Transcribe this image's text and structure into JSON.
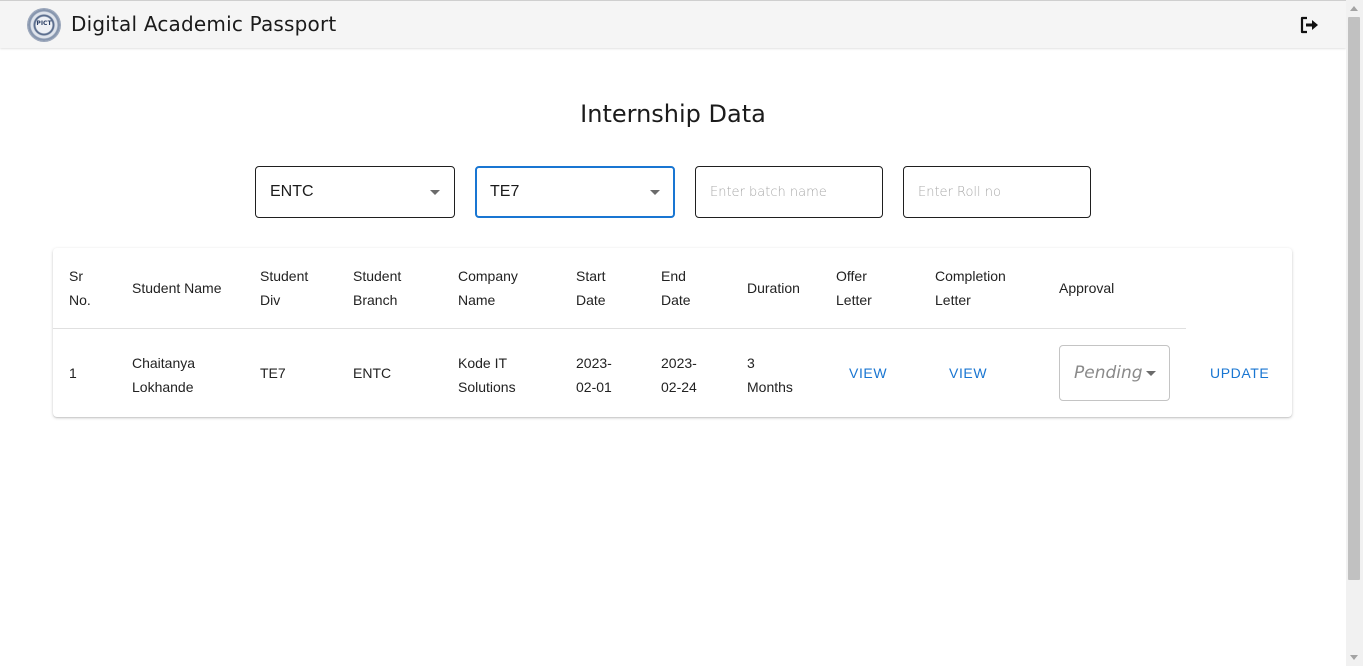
{
  "header": {
    "logo_text": "PICT",
    "app_title": "Digital Academic Passport",
    "logout_icon": "logout-icon"
  },
  "page": {
    "title": "Internship Data"
  },
  "filters": {
    "branch": {
      "value": "ENTC"
    },
    "division": {
      "value": "TE7"
    },
    "batch": {
      "placeholder": "Enter batch name",
      "value": ""
    },
    "roll": {
      "placeholder": "Enter Roll no",
      "value": ""
    }
  },
  "table": {
    "headers": {
      "sr": [
        "Sr",
        "No."
      ],
      "name": [
        "Student Name"
      ],
      "div": [
        "Student",
        "Div"
      ],
      "branch": [
        "Student",
        "Branch"
      ],
      "company": [
        "Company",
        "Name"
      ],
      "start": [
        "Start",
        "Date"
      ],
      "end": [
        "End",
        "Date"
      ],
      "duration": [
        "Duration"
      ],
      "offer": [
        "Offer",
        "Letter"
      ],
      "completion": [
        "Completion",
        "Letter"
      ],
      "approval": [
        "Approval"
      ]
    },
    "rows": [
      {
        "sr": "1",
        "name": [
          "Chaitanya",
          "Lokhande"
        ],
        "div": "TE7",
        "branch": "ENTC",
        "company": [
          "Kode IT",
          "Solutions"
        ],
        "start": [
          "2023-",
          "02-01"
        ],
        "end": [
          "2023-",
          "02-24"
        ],
        "duration": [
          "3",
          "Months"
        ],
        "offer_label": "VIEW",
        "completion_label": "VIEW",
        "approval": "Pending",
        "update_label": "UPDATE"
      }
    ]
  },
  "colors": {
    "accent": "#1976d2",
    "topbar": "#f5f5f5",
    "text": "#222222"
  }
}
